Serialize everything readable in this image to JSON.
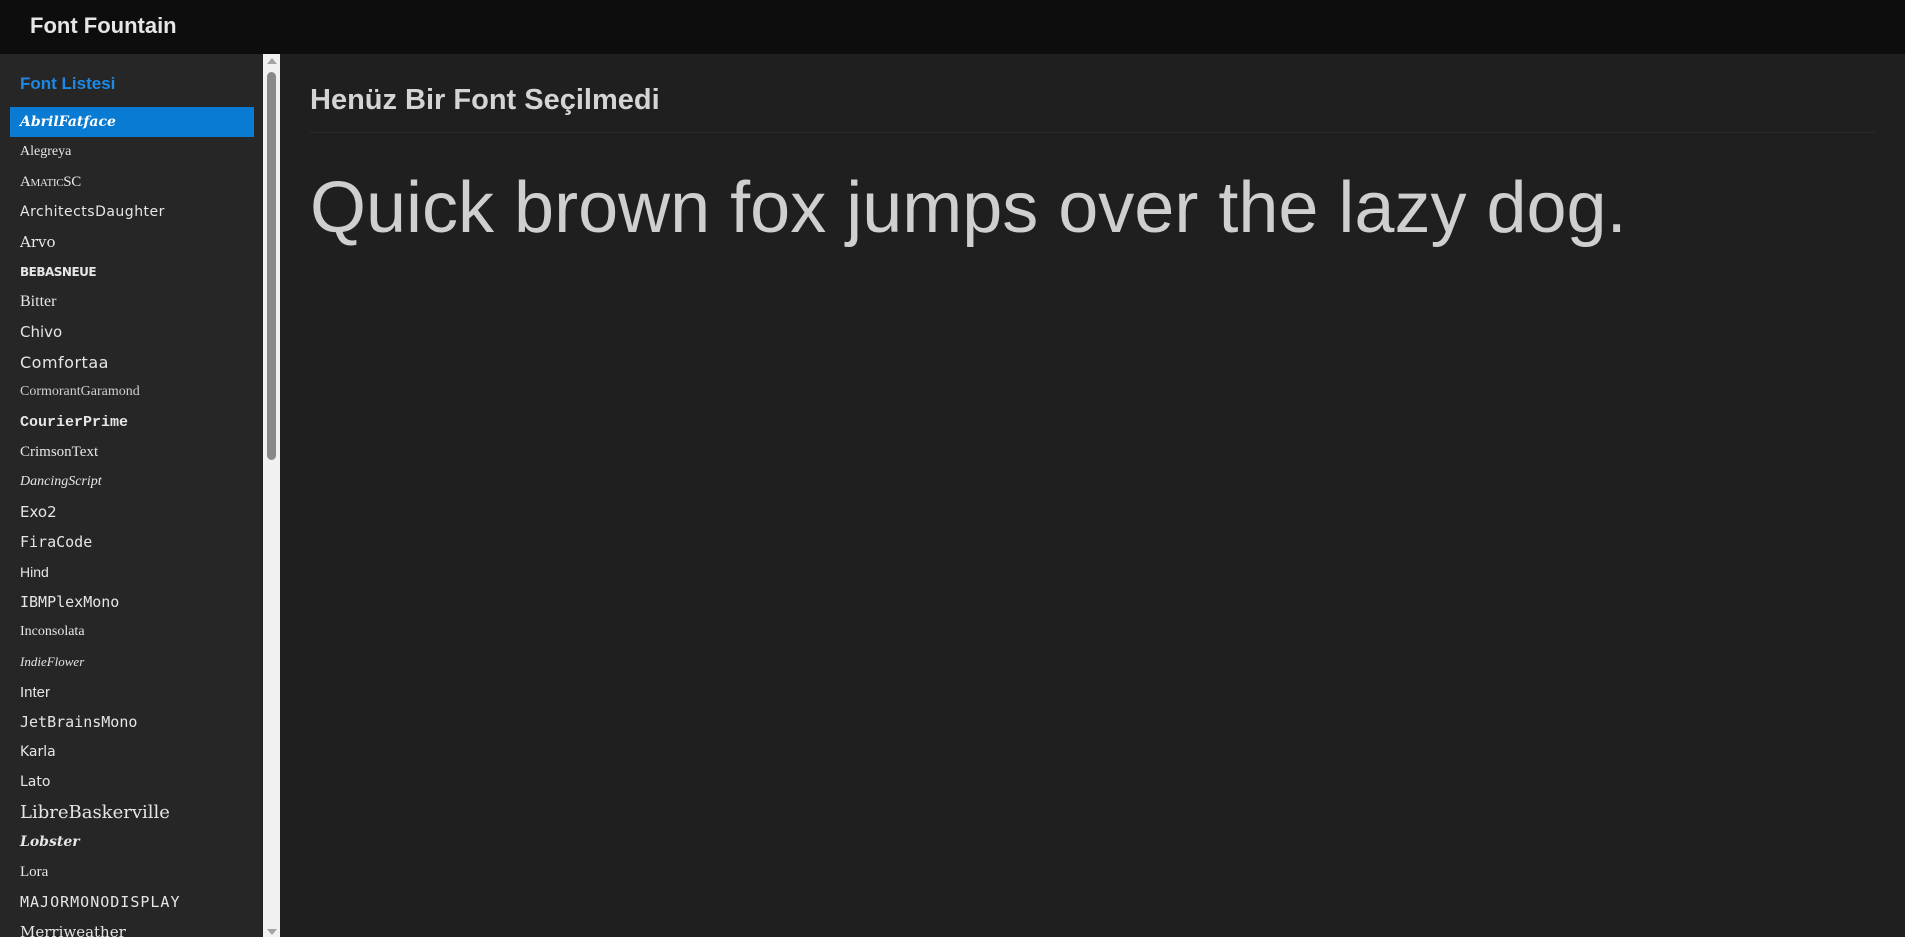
{
  "app": {
    "title": "Font Fountain"
  },
  "sidebar": {
    "title": "Font Listesi",
    "items": [
      {
        "label": "AbrilFatface",
        "active": true
      },
      {
        "label": "Alegreya"
      },
      {
        "label": "AmaticSC"
      },
      {
        "label": "ArchitectsDaughter"
      },
      {
        "label": "Arvo"
      },
      {
        "label": "BEBASNEUE"
      },
      {
        "label": "Bitter"
      },
      {
        "label": "Chivo"
      },
      {
        "label": "Comfortaa"
      },
      {
        "label": "CormorantGaramond"
      },
      {
        "label": "CourierPrime"
      },
      {
        "label": "CrimsonText"
      },
      {
        "label": "DancingScript"
      },
      {
        "label": "Exo2"
      },
      {
        "label": "FiraCode"
      },
      {
        "label": "Hind"
      },
      {
        "label": "IBMPlexMono"
      },
      {
        "label": "Inconsolata"
      },
      {
        "label": "IndieFlower"
      },
      {
        "label": "Inter"
      },
      {
        "label": "JetBrainsMono"
      },
      {
        "label": "Karla"
      },
      {
        "label": "Lato"
      },
      {
        "label": "LibreBaskerville"
      },
      {
        "label": "Lobster"
      },
      {
        "label": "Lora"
      },
      {
        "label": "MAJORMONODISPLAY"
      },
      {
        "label": "Merriweather"
      }
    ]
  },
  "main": {
    "heading": "Henüz Bir Font Seçilmedi",
    "preview": "Quick brown fox jumps over the lazy dog."
  },
  "colors": {
    "accent": "#0a7bd2",
    "sidebar_title": "#1e88e5",
    "background": "#1f1f1f",
    "topbar": "#0d0d0d"
  }
}
